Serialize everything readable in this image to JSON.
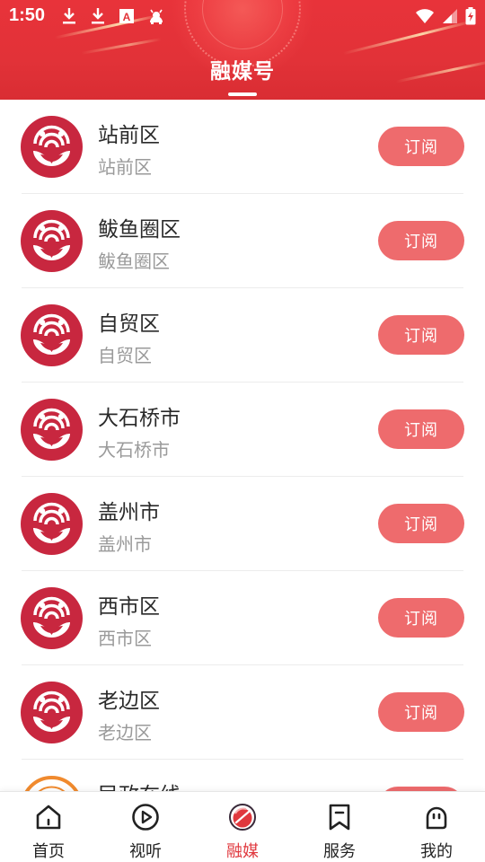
{
  "status_bar": {
    "time": "1:50",
    "left_icons": [
      "download-icon",
      "download-icon",
      "a-box-icon",
      "android-icon"
    ],
    "right_icons": [
      "wifi-icon",
      "signal-icon",
      "battery-charging-icon"
    ]
  },
  "header": {
    "title": "融媒号"
  },
  "list": {
    "items": [
      {
        "name": "站前区",
        "subtitle": "站前区",
        "button": "订阅",
        "avatar": "media-logo-icon"
      },
      {
        "name": "鲅鱼圈区",
        "subtitle": "鲅鱼圈区",
        "button": "订阅",
        "avatar": "media-logo-icon"
      },
      {
        "name": "自贸区",
        "subtitle": "自贸区",
        "button": "订阅",
        "avatar": "media-logo-icon"
      },
      {
        "name": "大石桥市",
        "subtitle": "大石桥市",
        "button": "订阅",
        "avatar": "media-logo-icon"
      },
      {
        "name": "盖州市",
        "subtitle": "盖州市",
        "button": "订阅",
        "avatar": "media-logo-icon"
      },
      {
        "name": "西市区",
        "subtitle": "西市区",
        "button": "订阅",
        "avatar": "media-logo-icon"
      },
      {
        "name": "老边区",
        "subtitle": "老边区",
        "button": "订阅",
        "avatar": "media-logo-icon"
      },
      {
        "name": "民政在线",
        "subtitle": "",
        "button": "订阅",
        "avatar": "civil-affairs-logo-icon"
      }
    ]
  },
  "bottom_nav": {
    "items": [
      {
        "label": "首页",
        "icon": "home-icon",
        "active": false
      },
      {
        "label": "视听",
        "icon": "play-icon",
        "active": false
      },
      {
        "label": "融媒",
        "icon": "rongmei-icon",
        "active": true
      },
      {
        "label": "服务",
        "icon": "bookmark-icon",
        "active": false
      },
      {
        "label": "我的",
        "icon": "profile-face-icon",
        "active": false
      }
    ]
  },
  "colors": {
    "header_red": "#e23238",
    "button_red": "#ee6b6d",
    "logo_red": "#c8273f",
    "active_nav": "#e0383e",
    "orange_logo": "#f08a2e"
  }
}
